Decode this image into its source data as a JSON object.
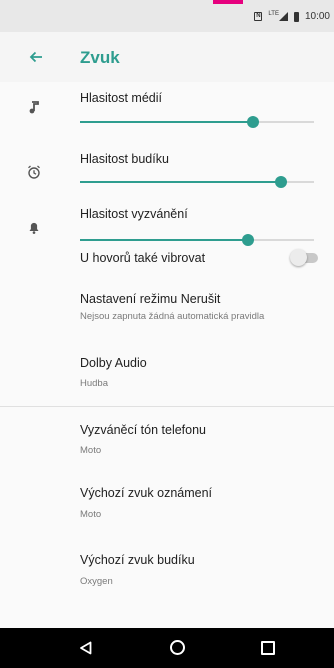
{
  "status_bar": {
    "nfc_label": "N",
    "network_label": "LTE",
    "time": "10:00",
    "accent_color": "#e6007e"
  },
  "header": {
    "title": "Zvuk",
    "back_icon": "arrow-left-icon"
  },
  "volume": {
    "media": {
      "label": "Hlasitost médií",
      "icon": "music-note-icon",
      "level": 0.74
    },
    "alarm": {
      "label": "Hlasitost budíku",
      "icon": "alarm-clock-icon",
      "level": 0.86
    },
    "ring": {
      "label": "Hlasitost vyzvánění",
      "icon": "bell-icon",
      "level": 0.72
    }
  },
  "vibrate": {
    "label": "U hovorů také vibrovat",
    "on": false
  },
  "preferences": [
    {
      "title": "Nastavení režimu Nerušit",
      "summary": "Nejsou zapnuta žádná automatická pravidla"
    },
    {
      "title": "Dolby Audio",
      "summary": "Hudba"
    },
    {
      "title": "Vyzváněcí tón telefonu",
      "summary": "Moto"
    },
    {
      "title": "Výchozí zvuk oznámení",
      "summary": "Moto"
    },
    {
      "title": "Výchozí zvuk budíku",
      "summary": "Oxygen"
    }
  ],
  "colors": {
    "accent": "#2e9d8f"
  },
  "nav_bar": {
    "back_icon": "triangle-back-icon",
    "home_icon": "circle-home-icon",
    "recents_icon": "square-recents-icon"
  }
}
